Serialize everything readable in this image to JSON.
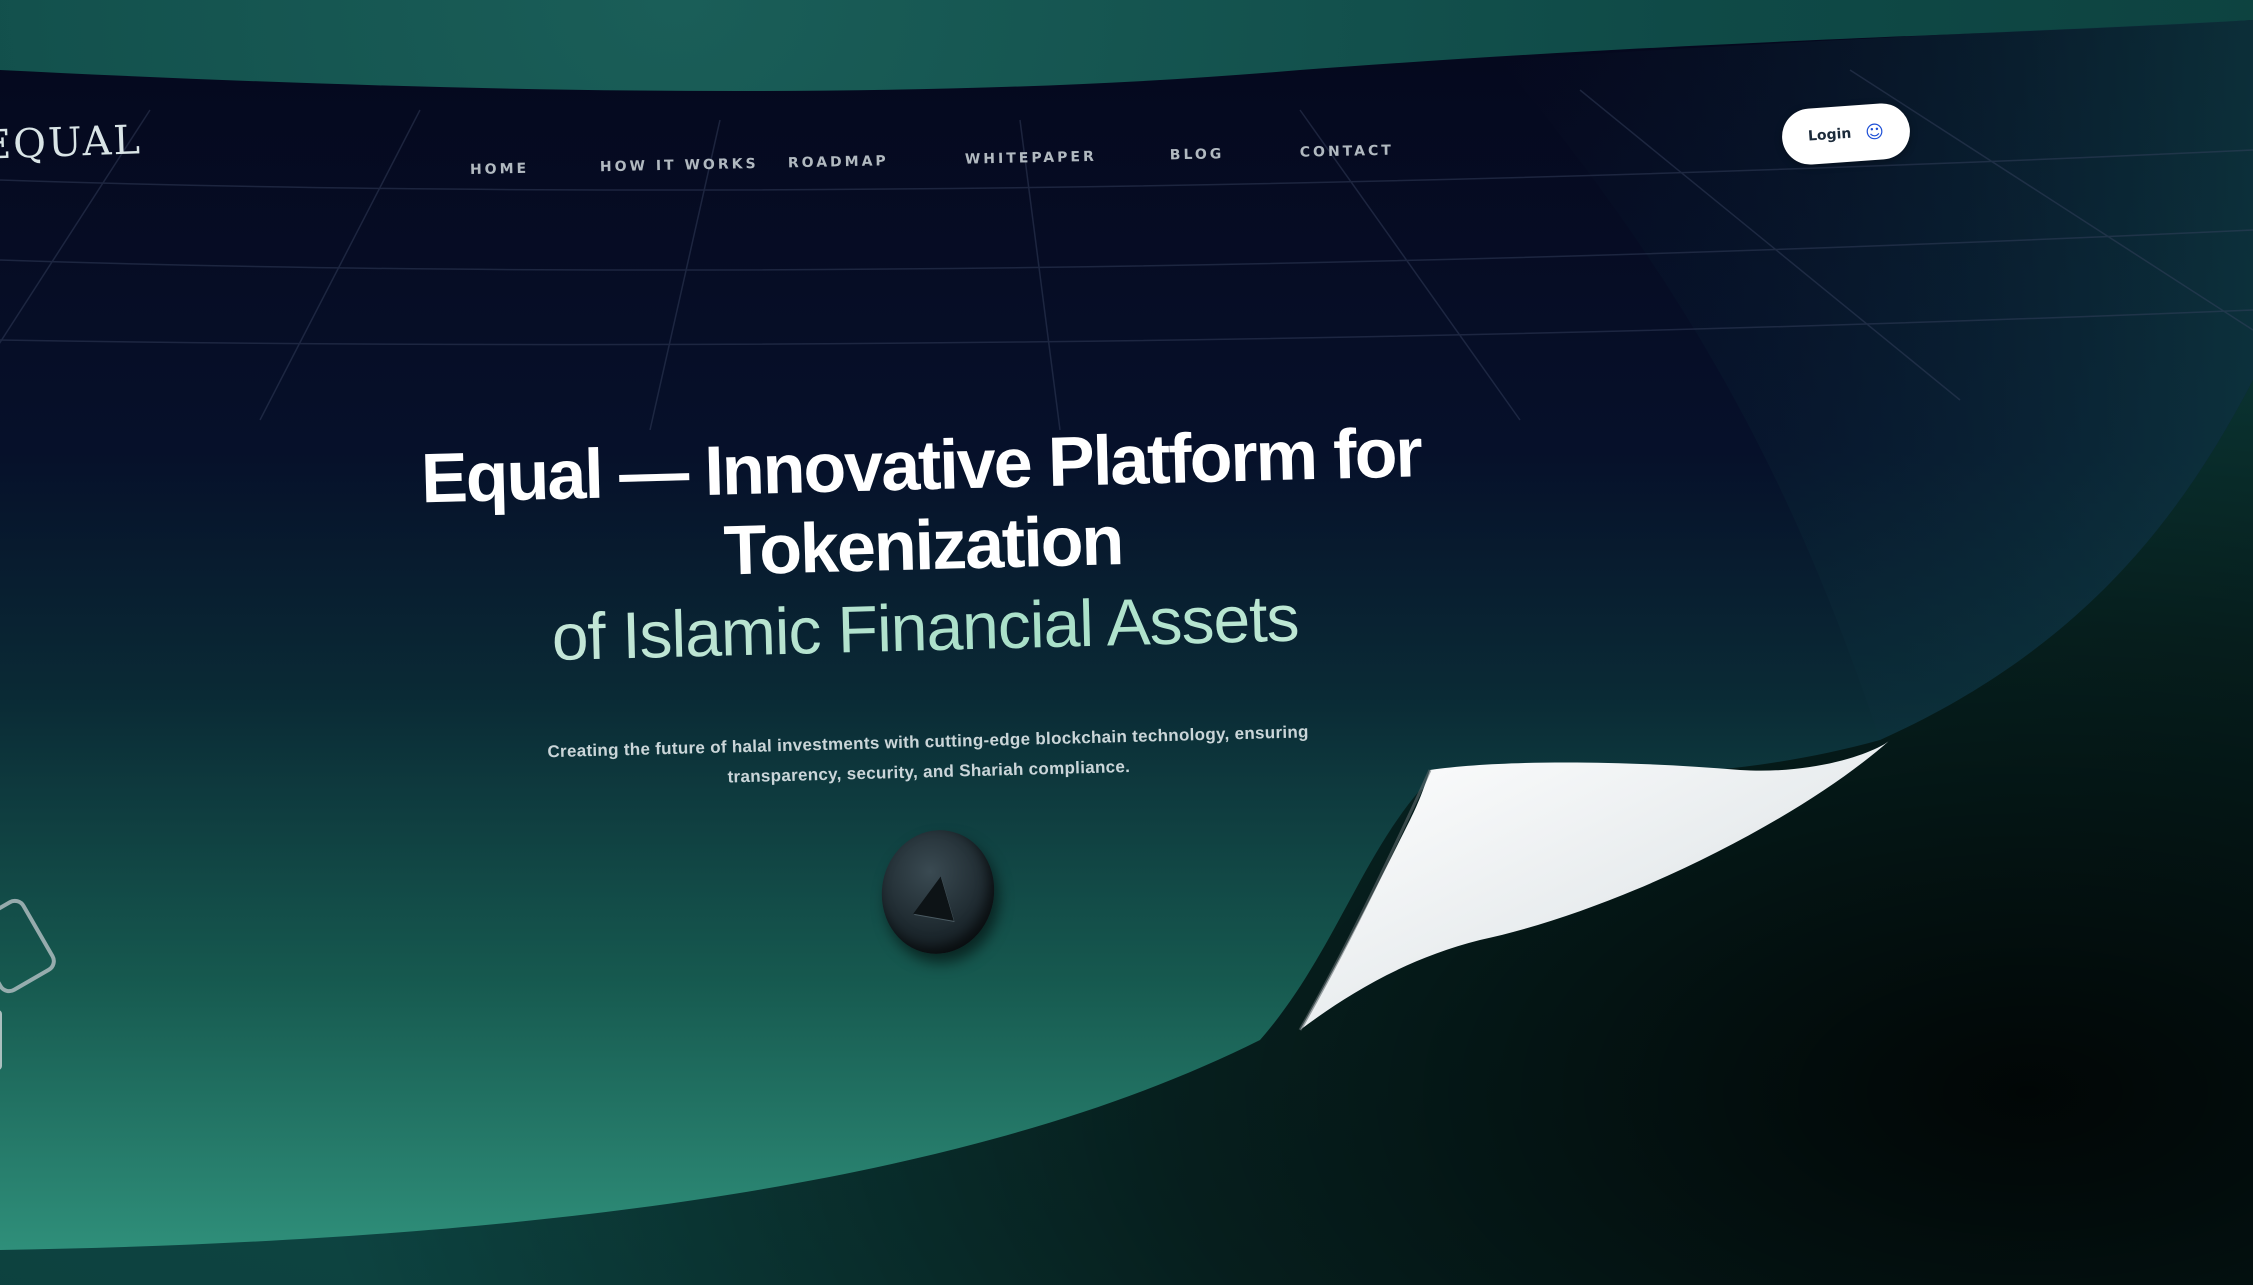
{
  "header": {
    "logo_text": "EQUAL",
    "nav_items": [
      {
        "label": "HOME"
      },
      {
        "label": "HOW IT WORKS"
      },
      {
        "label": "ROADMAP"
      },
      {
        "label": "WHITEPAPER"
      },
      {
        "label": "BLOG"
      },
      {
        "label": "CONTACT"
      }
    ],
    "login": {
      "label": "Login",
      "icon": "user-icon"
    }
  },
  "hero": {
    "title_line1": "Equal — Innovative Platform for",
    "title_line2": "Tokenization",
    "title_line3": "of Islamic Financial Assets",
    "subtitle": "Creating the future of halal investments with cutting-edge blockchain technology, ensuring transparency, security, and Shariah compliance."
  },
  "decor": {
    "coin_icon": "equal-coin-icon",
    "side_icon": "wallet-icon"
  },
  "colors": {
    "page_background": "#0a0b22",
    "backdrop": "#0f4a47",
    "accent_text": "#a8e0c8",
    "login_icon": "#1d4fd6"
  }
}
